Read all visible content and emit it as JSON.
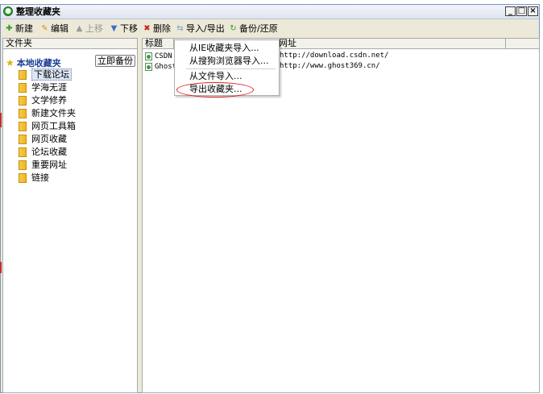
{
  "window": {
    "title": "整理收藏夹",
    "minimize": "_",
    "maximize": "□",
    "close": "×"
  },
  "toolbar": {
    "new_label": "新建",
    "edit_label": "编辑",
    "move_up_label": "上移",
    "move_down_label": "下移",
    "delete_label": "删除",
    "import_export_label": "导入/导出",
    "backup_restore_label": "备份/还原"
  },
  "folder_panel": {
    "header": "文件夹",
    "root_label": "本地收藏夹",
    "backup_button": "立即备份",
    "items": [
      {
        "label": "下载论坛",
        "selected": true
      },
      {
        "label": "学海无涯"
      },
      {
        "label": "文学修养"
      },
      {
        "label": "新建文件夹"
      },
      {
        "label": "网页工具箱"
      },
      {
        "label": "网页收藏"
      },
      {
        "label": "论坛收藏"
      },
      {
        "label": "重要网址"
      },
      {
        "label": "链接"
      }
    ]
  },
  "bookmark_list": {
    "columns": [
      "标题",
      "网址"
    ],
    "rows": [
      {
        "title": "CSDN",
        "url": "http://download.csdn.net/"
      },
      {
        "title": "Ghost",
        "url": "http://www.ghost369.cn/"
      }
    ]
  },
  "import_export_menu": {
    "items": [
      "从IE收藏夹导入...",
      "从搜狗浏览器导入...",
      "从文件导入...",
      "导出收藏夹..."
    ],
    "highlighted_index": 3
  },
  "colors": {
    "window_bg": "#ece9d8",
    "root_label": "#1c3f94",
    "highlight_ellipse": "#e01e1e",
    "folder": "#f1b623"
  }
}
